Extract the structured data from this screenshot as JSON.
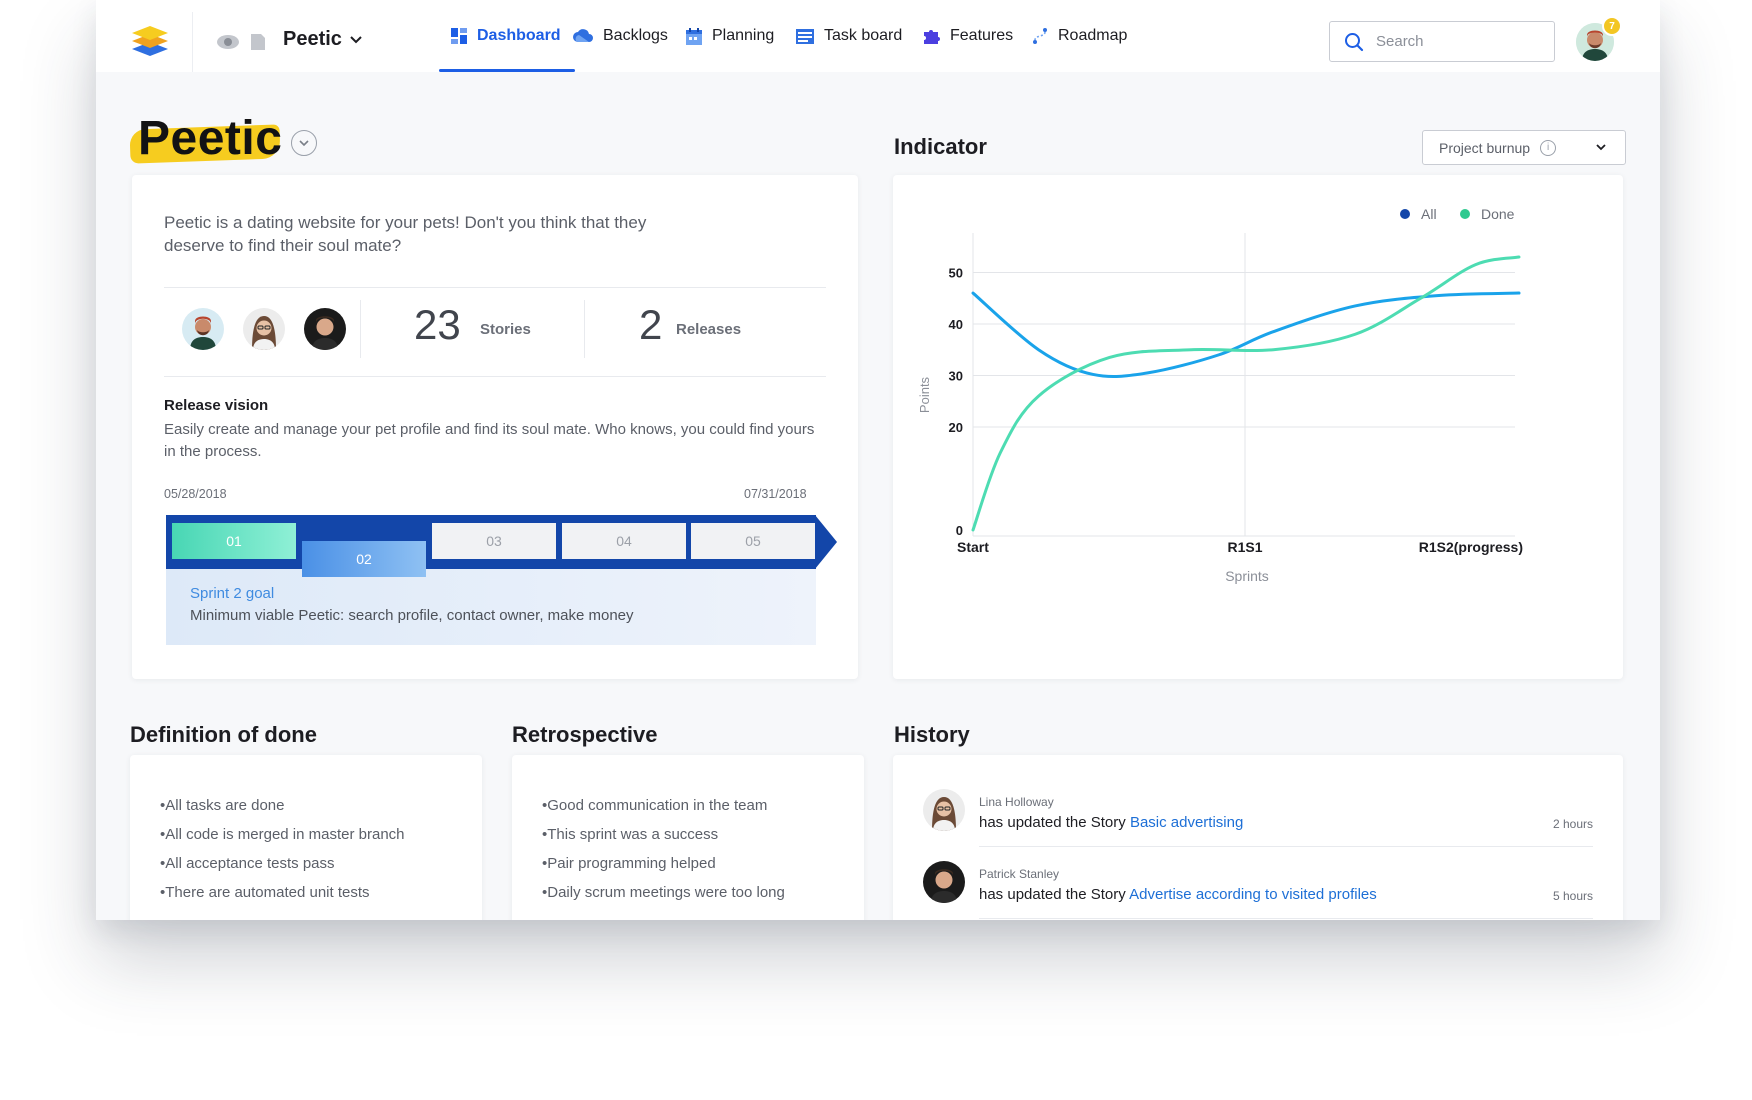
{
  "navbar": {
    "project_name": "Peetic",
    "tabs": [
      {
        "label": "Dashboard",
        "icon": "dashboard-icon",
        "active": true
      },
      {
        "label": "Backlogs",
        "icon": "cloud-icon"
      },
      {
        "label": "Planning",
        "icon": "calendar-icon"
      },
      {
        "label": "Task board",
        "icon": "task-board-icon"
      },
      {
        "label": "Features",
        "icon": "puzzle-icon"
      },
      {
        "label": "Roadmap",
        "icon": "roadmap-icon"
      }
    ],
    "search_placeholder": "Search",
    "notification_count": "7"
  },
  "project": {
    "title": "Peetic",
    "description": "Peetic is a dating website for your pets! Don't you think that they deserve to find their soul mate?",
    "stories_count": "23",
    "stories_label": "Stories",
    "releases_count": "2",
    "releases_label": "Releases",
    "release_vision_title": "Release vision",
    "release_vision_text": "Easily create and manage your pet profile and find its soul mate. Who knows, you could find yours in the process.",
    "start_date": "05/28/2018",
    "end_date": "07/31/2018",
    "sprints": [
      "01",
      "02",
      "03",
      "04",
      "05"
    ],
    "sprint_goal_title": "Sprint 2 goal",
    "sprint_goal_text": "Minimum viable Peetic: search profile, contact owner, make money"
  },
  "indicator": {
    "title": "Indicator",
    "selector_label": "Project burnup",
    "info_symbol": "i"
  },
  "chart_data": {
    "type": "line",
    "title": "",
    "xlabel": "Sprints",
    "ylabel": "Points",
    "categories": [
      "Start",
      "R1S1",
      "R1S2(progress)"
    ],
    "yticks": [
      0,
      20,
      30,
      40,
      50
    ],
    "grid": true,
    "legend_position": "top-right",
    "series": [
      {
        "name": "All",
        "color": "#1aa3ea",
        "legend_color": "#1346a9",
        "points": [
          [
            0,
            46
          ],
          [
            0.12,
            35
          ],
          [
            0.22,
            30.2
          ],
          [
            0.32,
            30.5
          ],
          [
            0.45,
            34
          ],
          [
            0.55,
            38.5
          ],
          [
            0.7,
            43.5
          ],
          [
            0.85,
            45.5
          ],
          [
            1.0,
            46
          ]
        ]
      },
      {
        "name": "Done",
        "color": "#4ddcb2",
        "legend_color": "#2ec98f",
        "points": [
          [
            0,
            0
          ],
          [
            0.05,
            15
          ],
          [
            0.12,
            26
          ],
          [
            0.25,
            33.5
          ],
          [
            0.4,
            35
          ],
          [
            0.55,
            35
          ],
          [
            0.7,
            38
          ],
          [
            0.82,
            45
          ],
          [
            0.92,
            51.5
          ],
          [
            1.0,
            53
          ]
        ]
      }
    ]
  },
  "definition_of_done": {
    "title": "Definition of done",
    "items": [
      "•All tasks are done",
      "•All code is merged in master branch",
      "•All acceptance tests pass",
      "•There are automated unit tests"
    ]
  },
  "retrospective": {
    "title": "Retrospective",
    "items": [
      "•Good communication in the team",
      "•This sprint was a success",
      "•Pair programming helped",
      "•Daily scrum meetings were too long"
    ]
  },
  "history": {
    "title": "History",
    "items": [
      {
        "name": "Lina Holloway",
        "action": "has updated the Story ",
        "link": "Basic advertising",
        "time": "2 hours"
      },
      {
        "name": "Patrick Stanley",
        "action": "has updated the Story ",
        "link": "Advertise according to visited profiles",
        "time": "5 hours"
      }
    ]
  }
}
